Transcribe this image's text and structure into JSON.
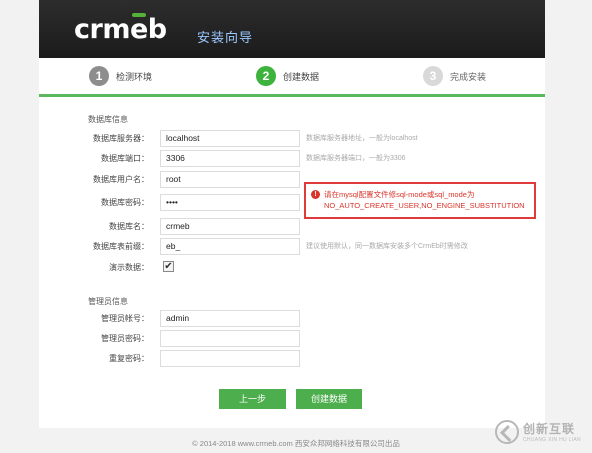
{
  "header": {
    "logo_part1": "crm",
    "logo_part2": "e",
    "logo_part3": "b",
    "title": "安装向导"
  },
  "steps": [
    {
      "num": "1",
      "label": "检测环境"
    },
    {
      "num": "2",
      "label": "创建数据"
    },
    {
      "num": "3",
      "label": "完成安装"
    }
  ],
  "db_section": {
    "title": "数据库信息",
    "fields": [
      {
        "label": "数据库服务器：",
        "value": "localhost",
        "hint": "数据库服务器地址，一般为localhost"
      },
      {
        "label": "数据库端口：",
        "value": "3306",
        "hint": "数据库服务器端口，一般为3306"
      },
      {
        "label": "数据库用户名：",
        "value": "root",
        "hint": ""
      },
      {
        "label": "数据库密码：",
        "value": "••••",
        "hint": ""
      },
      {
        "label": "数据库名：",
        "value": "crmeb",
        "hint": ""
      },
      {
        "label": "数据库表前缀：",
        "value": "eb_",
        "hint": "建议使用默认，同一数据库安装多个CrmEb时需修改"
      }
    ],
    "demo_label": "演示数据：",
    "demo_checked": "✔"
  },
  "error": {
    "icon": "!",
    "message": "请在mysql配置文件修sql-mode或sql_mode为NO_AUTO_CREATE_USER,NO_ENGINE_SUBSTITUTION"
  },
  "admin_section": {
    "title": "管理员信息",
    "fields": [
      {
        "label": "管理员帐号：",
        "value": "admin"
      },
      {
        "label": "管理员密码：",
        "value": ""
      },
      {
        "label": "重复密码：",
        "value": ""
      }
    ]
  },
  "buttons": {
    "prev": "上一步",
    "next": "创建数据"
  },
  "footer": "© 2014-2018 www.crmeb.com 西安众邦网络科技有限公司出品",
  "watermark": {
    "main": "创新互联",
    "sub": "CHUANG XIN HU LIAN"
  },
  "colors": {
    "accent_green": "#4cae4c",
    "error_red": "#d9342b",
    "header_bg": "#1f1f1f"
  }
}
